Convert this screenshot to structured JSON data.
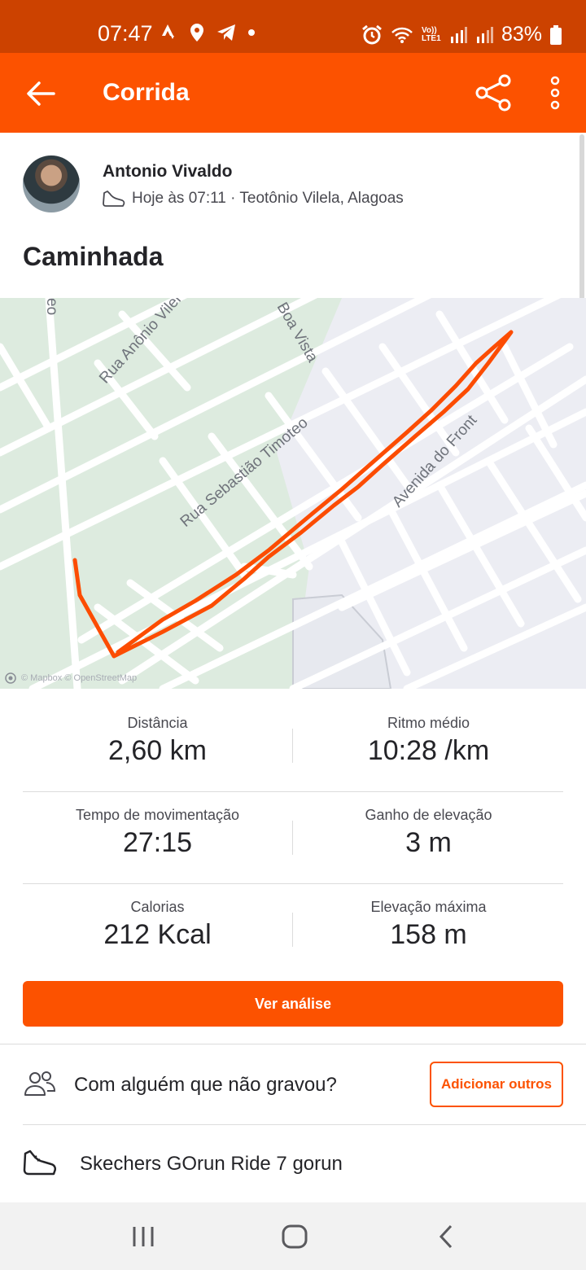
{
  "status_bar": {
    "time": "07:47",
    "network_label": "Vo)) LTE1",
    "battery": "83%"
  },
  "app_bar": {
    "title": "Corrida"
  },
  "athlete": {
    "name": "Antonio Vivaldo",
    "when_where": "Hoje às 07:11 · Teotônio Vilela, Alagoas"
  },
  "activity": {
    "title": "Caminhada"
  },
  "map": {
    "street_labels": [
      "Rua Anônio Vilel",
      "Boa Vista",
      "eo",
      "Rua Sebastião Timoteo",
      "Avenida do Front"
    ],
    "attribution": "© Mapbox © OpenStreetMap",
    "route_color": "#fc4c02"
  },
  "stats": [
    {
      "label": "Distância",
      "value": "2,60 km"
    },
    {
      "label": "Ritmo médio",
      "value": "10:28 /km"
    },
    {
      "label": "Tempo de movimentação",
      "value": "27:15"
    },
    {
      "label": "Ganho de elevação",
      "value": "3 m"
    },
    {
      "label": "Calorias",
      "value": "212 Kcal"
    },
    {
      "label": "Elevação máxima",
      "value": "158 m"
    }
  ],
  "actions": {
    "analysis_button": "Ver análise",
    "with_someone_text": "Com alguém que não gravou?",
    "add_others_button": "Adicionar outros"
  },
  "gear": {
    "name": "Skechers GOrun Ride 7 gorun"
  },
  "colors": {
    "brand": "#fc5200",
    "status_bar": "#cc4200"
  }
}
